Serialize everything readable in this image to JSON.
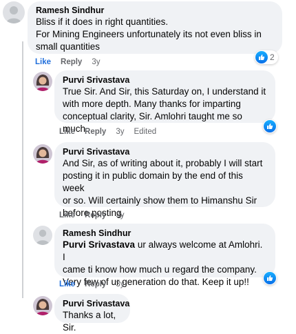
{
  "comments": [
    {
      "author": "Ramesh Sindhur",
      "lines": [
        "Bliss if it does in right quantities.",
        "For Mining Engineers unfortunately its not even bliss in",
        "small quantities"
      ],
      "actions": {
        "like": "Like",
        "reply": "Reply",
        "time": "3y"
      },
      "reaction_count": "2"
    },
    {
      "author": "Purvi Srivastava",
      "lines": [
        "True Sir. And Sir, this Saturday on, I understand it",
        "with more depth. Many thanks for imparting",
        "conceptual clarity, Sir. Amlohri taught me so much."
      ],
      "actions": {
        "like": "Like",
        "reply": "Reply",
        "time": "3y",
        "edited": "Edited"
      }
    },
    {
      "author": "Purvi Srivastava",
      "lines": [
        "And Sir, as of writing about it, probably I will start",
        "posting it in public domain by the end of this week",
        "or so. Will certainly show them to Himanshu Sir",
        "before posting."
      ],
      "actions": {
        "like": "Like",
        "reply": "Reply",
        "time": "3y"
      }
    },
    {
      "author": "Ramesh Sindhur",
      "mention": "Purvi Srivastava",
      "lines": [
        " ur always welcome at Amlohri. I",
        "came ti know how much u regard the company.",
        "Very few of ur generation do that. Keep it up!!"
      ],
      "actions": {
        "like": "Like",
        "reply": "Reply",
        "time": "3y"
      }
    },
    {
      "author": "Purvi Srivastava",
      "lines": [
        "Thanks a lot, Sir."
      ]
    }
  ],
  "colors": {
    "like_active": "#216fdb",
    "bubble": "#f0f2f5",
    "meta": "#65676b"
  }
}
